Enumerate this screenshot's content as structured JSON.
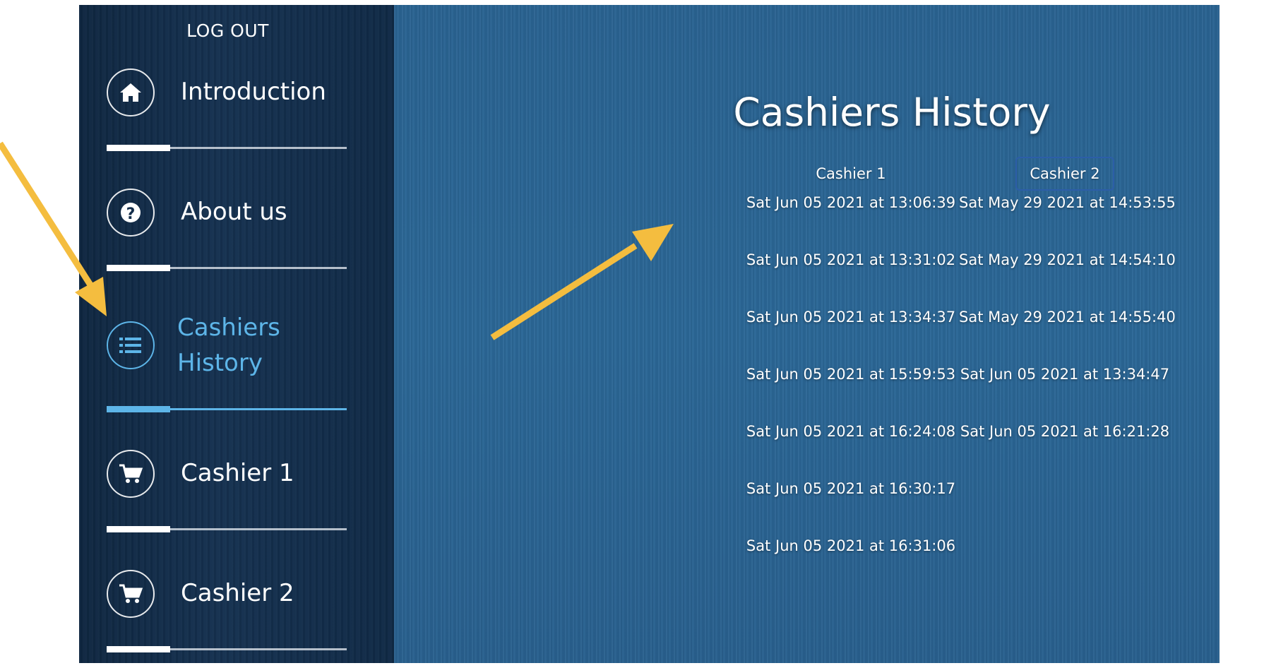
{
  "sidebar": {
    "logout_label": "LOG OUT",
    "items": [
      {
        "label": "Introduction",
        "icon": "home-icon"
      },
      {
        "label": "About us",
        "icon": "question-icon"
      },
      {
        "label": "Cashiers History",
        "icon": "list-icon",
        "active": true
      },
      {
        "label": "Cashier 1",
        "icon": "cart-icon"
      },
      {
        "label": "Cashier 2",
        "icon": "cart-icon"
      }
    ]
  },
  "main": {
    "title": "Cashiers History",
    "columns": [
      {
        "header": "Cashier 1",
        "entries": [
          "Sat Jun 05 2021 at 13:06:39",
          "Sat Jun 05 2021 at 13:31:02",
          "Sat Jun 05 2021 at 13:34:37",
          "Sat Jun 05 2021 at 15:59:53",
          "Sat Jun 05 2021 at 16:24:08",
          "Sat Jun 05 2021 at 16:30:17",
          "Sat Jun 05 2021 at 16:31:06"
        ]
      },
      {
        "header": "Cashier 2",
        "selected": true,
        "entries": [
          "Sat May 29 2021 at 14:53:55",
          "Sat May 29 2021 at 14:54:10",
          "Sat May 29 2021 at 14:55:40",
          "Sat Jun 05 2021 at 13:34:47",
          "Sat Jun 05 2021 at 16:21:28"
        ]
      }
    ]
  },
  "colors": {
    "active_accent": "#5db5e8",
    "annotation_arrow": "#f4bd3f",
    "sidebar_bg": "#132d4a",
    "main_bg": "#2a6391"
  }
}
